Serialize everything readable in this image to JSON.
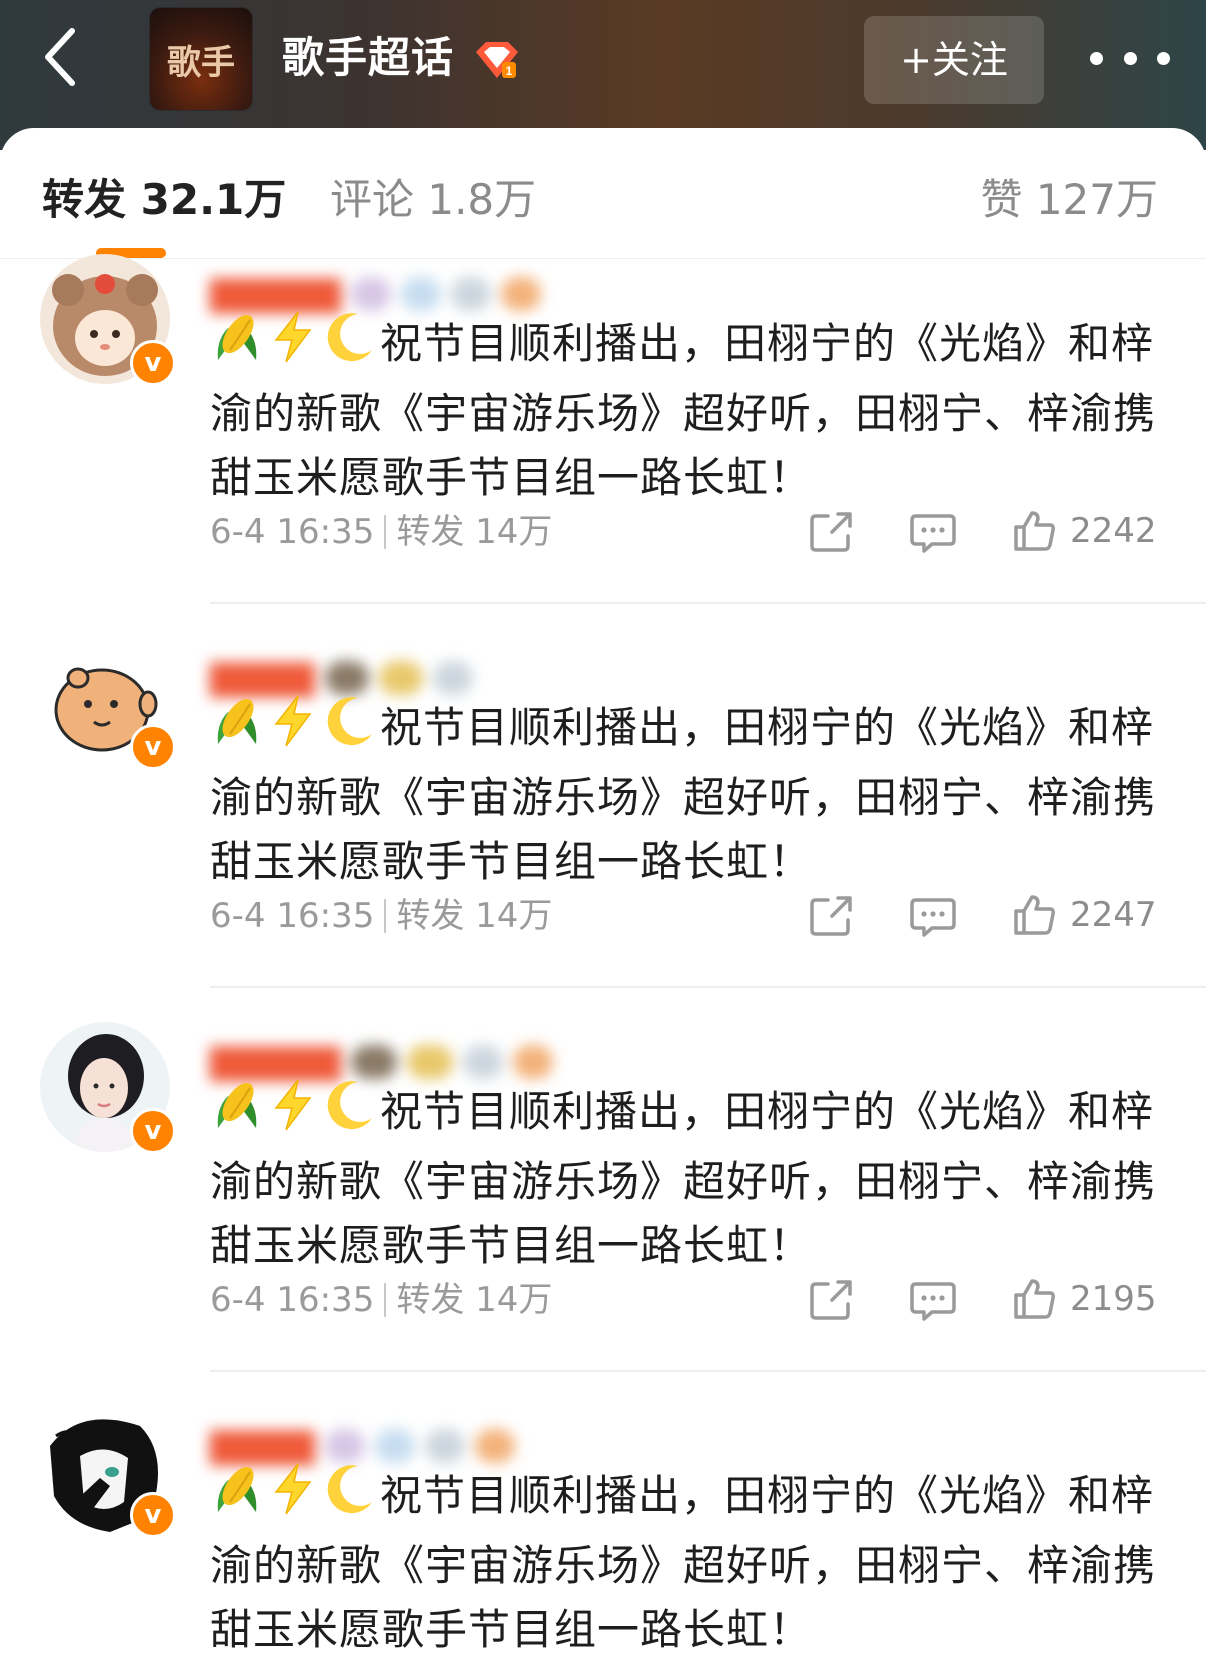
{
  "header": {
    "logo_text": "歌手",
    "title": "歌手超话",
    "follow_label": "+关注"
  },
  "tabs": [
    {
      "label": "转发 32.1万",
      "active": true
    },
    {
      "label": "评论 1.8万",
      "active": false
    },
    {
      "label": "赞 127万",
      "active": false
    }
  ],
  "colors": {
    "accent": "#ff8200",
    "header_gradient": [
      "#2f3a3f",
      "#5a3a24",
      "#2e4548"
    ],
    "username_blurred": "#ef5a3a"
  },
  "posts": [
    {
      "avatar_icon": "bear-hat-avatar-icon",
      "content": "祝节目顺利播出，田栩宁的《光焰》和梓渝的新歌《宇宙游乐场》超好听，田栩宁、梓渝携甜玉米愿歌手节目组一路长虹！",
      "time": "6-4 16:35",
      "repost": "转发 14万",
      "likes": "2242"
    },
    {
      "avatar_icon": "cartoon-pig-avatar-icon",
      "content": "祝节目顺利播出，田栩宁的《光焰》和梓渝的新歌《宇宙游乐场》超好听，田栩宁、梓渝携甜玉米愿歌手节目组一路长虹！",
      "time": "6-4 16:35",
      "repost": "转发 14万",
      "likes": "2247"
    },
    {
      "avatar_icon": "girl-portrait-avatar-icon",
      "content": "祝节目顺利播出，田栩宁的《光焰》和梓渝的新歌《宇宙游乐场》超好听，田栩宁、梓渝携甜玉米愿歌手节目组一路长虹！",
      "time": "6-4 16:35",
      "repost": "转发 14万",
      "likes": "2195"
    },
    {
      "avatar_icon": "anime-sketch-avatar-icon",
      "content": "祝节目顺利播出，田栩宁的《光焰》和梓渝的新歌《宇宙游乐场》超好听，田栩宁、梓渝携甜玉米愿歌手节目组一路长虹！",
      "time": "",
      "repost": "",
      "likes": ""
    }
  ]
}
